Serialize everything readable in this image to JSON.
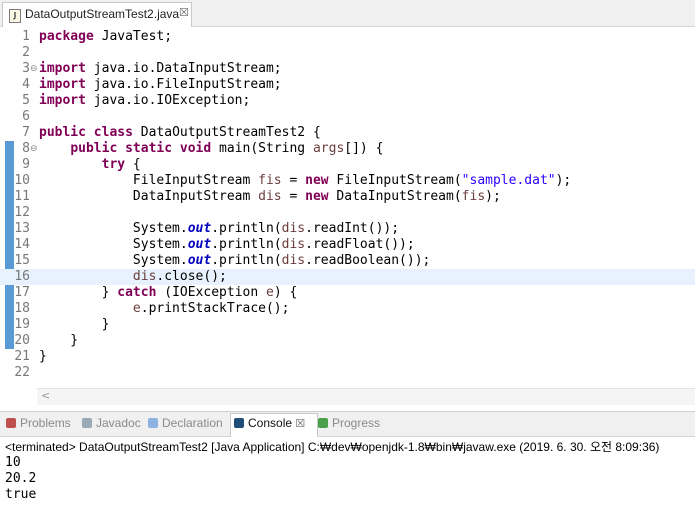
{
  "editor": {
    "tab_label": "DataOutputStreamTest2.java",
    "tab_close": "☒",
    "file_icon": "J",
    "lines": [
      {
        "n": "1",
        "tokens": [
          [
            "kw",
            "package"
          ],
          [
            "p",
            " JavaTest;"
          ]
        ]
      },
      {
        "n": "2",
        "tokens": []
      },
      {
        "n": "3",
        "fold": "⊖",
        "tokens": [
          [
            "kw",
            "import"
          ],
          [
            "p",
            " java.io.DataInputStream;"
          ]
        ]
      },
      {
        "n": "4",
        "tokens": [
          [
            "kw",
            "import"
          ],
          [
            "p",
            " java.io.FileInputStream;"
          ]
        ]
      },
      {
        "n": "5",
        "tokens": [
          [
            "kw",
            "import"
          ],
          [
            "p",
            " java.io.IOException;"
          ]
        ]
      },
      {
        "n": "6",
        "tokens": []
      },
      {
        "n": "7",
        "tokens": [
          [
            "kw",
            "public"
          ],
          [
            "p",
            " "
          ],
          [
            "kw",
            "class"
          ],
          [
            "p",
            " DataOutputStreamTest2 {"
          ]
        ]
      },
      {
        "n": "8",
        "fold": "⊖",
        "tokens": [
          [
            "p",
            "    "
          ],
          [
            "kw",
            "public"
          ],
          [
            "p",
            " "
          ],
          [
            "kw",
            "static"
          ],
          [
            "p",
            " "
          ],
          [
            "kw",
            "void"
          ],
          [
            "p",
            " main(String "
          ],
          [
            "var",
            "args"
          ],
          [
            "p",
            "[]) {"
          ]
        ]
      },
      {
        "n": "9",
        "tokens": [
          [
            "p",
            "        "
          ],
          [
            "kw",
            "try"
          ],
          [
            "p",
            " {"
          ]
        ]
      },
      {
        "n": "10",
        "tokens": [
          [
            "p",
            "            FileInputStream "
          ],
          [
            "var",
            "fis"
          ],
          [
            "p",
            " = "
          ],
          [
            "kw",
            "new"
          ],
          [
            "p",
            " FileInputStream("
          ],
          [
            "str",
            "\"sample.dat\""
          ],
          [
            "p",
            ");"
          ]
        ]
      },
      {
        "n": "11",
        "tokens": [
          [
            "p",
            "            DataInputStream "
          ],
          [
            "var",
            "dis"
          ],
          [
            "p",
            " = "
          ],
          [
            "kw",
            "new"
          ],
          [
            "p",
            " DataInputStream("
          ],
          [
            "var",
            "fis"
          ],
          [
            "p",
            ");"
          ]
        ]
      },
      {
        "n": "12",
        "tokens": []
      },
      {
        "n": "13",
        "tokens": [
          [
            "p",
            "            System."
          ],
          [
            "fld",
            "out"
          ],
          [
            "p",
            ".println("
          ],
          [
            "var",
            "dis"
          ],
          [
            "p",
            ".readInt());"
          ]
        ]
      },
      {
        "n": "14",
        "tokens": [
          [
            "p",
            "            System."
          ],
          [
            "fld",
            "out"
          ],
          [
            "p",
            ".println("
          ],
          [
            "var",
            "dis"
          ],
          [
            "p",
            ".readFloat());"
          ]
        ]
      },
      {
        "n": "15",
        "tokens": [
          [
            "p",
            "            System."
          ],
          [
            "fld",
            "out"
          ],
          [
            "p",
            ".println("
          ],
          [
            "var",
            "dis"
          ],
          [
            "p",
            ".readBoolean());"
          ]
        ]
      },
      {
        "n": "16",
        "current": true,
        "tokens": [
          [
            "p",
            "            "
          ],
          [
            "var",
            "dis"
          ],
          [
            "p",
            ".close();"
          ]
        ]
      },
      {
        "n": "17",
        "tokens": [
          [
            "p",
            "        } "
          ],
          [
            "kw",
            "catch"
          ],
          [
            "p",
            " (IOException "
          ],
          [
            "var",
            "e"
          ],
          [
            "p",
            ") {"
          ]
        ]
      },
      {
        "n": "18",
        "tokens": [
          [
            "p",
            "            "
          ],
          [
            "var",
            "e"
          ],
          [
            "p",
            ".printStackTrace();"
          ]
        ]
      },
      {
        "n": "19",
        "tokens": [
          [
            "p",
            "        }"
          ]
        ]
      },
      {
        "n": "20",
        "tokens": [
          [
            "p",
            "    }"
          ]
        ]
      },
      {
        "n": "21",
        "tokens": [
          [
            "p",
            "}"
          ]
        ]
      },
      {
        "n": "22",
        "tokens": []
      }
    ],
    "scroll_left": "<"
  },
  "console": {
    "tabs": [
      {
        "label": "Problems",
        "icon_color": "#c0504d",
        "active": false
      },
      {
        "label": "Javadoc",
        "icon_color": "#9aa8b8",
        "active": false
      },
      {
        "label": "Declaration",
        "icon_color": "#8db3e2",
        "active": false
      },
      {
        "label": "Console",
        "icon_color": "#1f4e79",
        "active": true,
        "close": "☒"
      },
      {
        "label": "Progress",
        "icon_color": "#4aa04a",
        "active": false
      }
    ],
    "status": "<terminated> DataOutputStreamTest2 [Java Application] C:₩dev₩openjdk-1.8₩bin₩javaw.exe (2019. 6. 30. 오전 8:09:36)",
    "output": [
      "10",
      "20.2",
      "true"
    ]
  }
}
